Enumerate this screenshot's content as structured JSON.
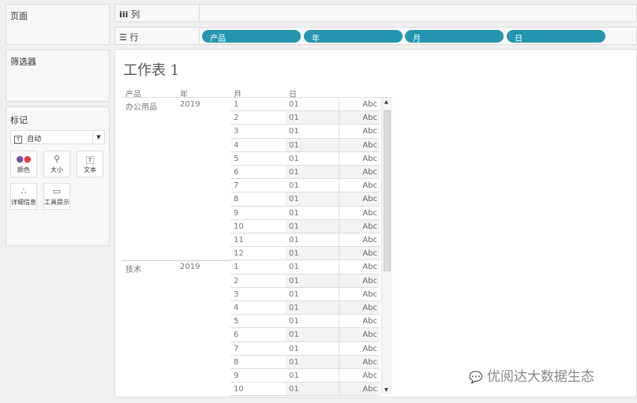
{
  "left": {
    "pages": "页面",
    "filters": "筛选器",
    "marks": {
      "title": "标记",
      "type": "自动",
      "buttons": [
        "颜色",
        "大小",
        "文本",
        "详细信息",
        "工具提示"
      ]
    }
  },
  "shelves": {
    "columns": "列",
    "rows": "行",
    "row_pills": [
      "产品",
      "年",
      "月",
      "日"
    ]
  },
  "sheet": {
    "title": "工作表 1",
    "headers": [
      "产品",
      "年",
      "月",
      "日"
    ],
    "groups": [
      {
        "product": "办公用品",
        "year": "2019",
        "months": [
          "1",
          "2",
          "3",
          "4",
          "5",
          "6",
          "7",
          "8",
          "9",
          "10",
          "11",
          "12"
        ]
      },
      {
        "product": "技术",
        "year": "2019",
        "months": [
          "1",
          "2",
          "3",
          "4",
          "5",
          "6",
          "7",
          "8",
          "9",
          "10"
        ]
      }
    ],
    "day": "01",
    "mark": "Abc"
  },
  "watermark": "优阅达大数据生态",
  "colors": {
    "pill": "#2596b0"
  }
}
